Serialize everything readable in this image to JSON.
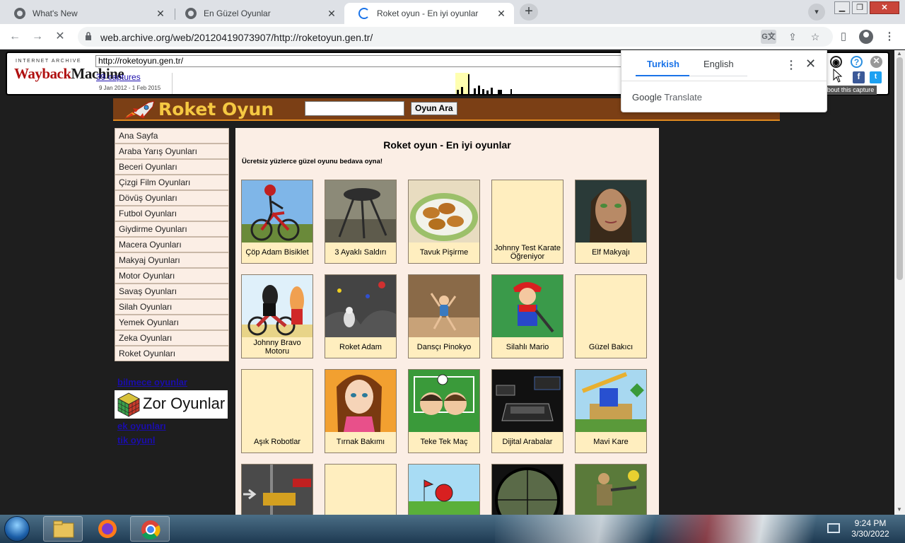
{
  "browser": {
    "tabs": [
      {
        "title": "What's New",
        "icon": "chrome-icon"
      },
      {
        "title": "En Güzel Oyunlar",
        "icon": "globe-icon"
      },
      {
        "title": "Roket oyun - En iyi oyunlar",
        "icon": "loading-spinner-icon",
        "active": true
      }
    ],
    "url": "web.archive.org/web/20120419073907/http://roketoyun.gen.tr/"
  },
  "wayback": {
    "brand_top": "INTERNET ARCHIVE",
    "brand_logo_a": "Wayback",
    "brand_logo_b": "Machine",
    "url_field": "http://roketoyun.gen.tr/",
    "captures": "39 captures",
    "date_range": "9 Jan 2012 - 1 Feb 2015",
    "about": "About this capture"
  },
  "translate_popup": {
    "lang_from": "Turkish",
    "lang_to": "English",
    "footer_brand": "Google",
    "footer_product": "Translate"
  },
  "site": {
    "title": "Roket Oyun",
    "search_button": "Oyun Ara",
    "search_value": ""
  },
  "sidebar": {
    "items": [
      "Ana Sayfa",
      "Araba Yarış Oyunları",
      "Beceri Oyunları",
      "Çizgi Film Oyunları",
      "Dövüş Oyunları",
      "Futbol Oyunları",
      "Giydirme Oyunları",
      "Macera Oyunları",
      "Makyaj Oyunları",
      "Motor Oyunları",
      "Savaş Oyunları",
      "Silah Oyunları",
      "Yemek Oyunları",
      "Zeka Oyunları",
      "Roket Oyunları"
    ],
    "links": [
      "bilmece oyunlar",
      "ek oyunları",
      "tik oyunl"
    ],
    "banner_text": "Zor Oyunlar"
  },
  "content": {
    "title": "Roket oyun - En iyi oyunlar",
    "subtitle": "Ücretsiz yüzlerce güzel oyunu bedava oyna!",
    "games": [
      {
        "label": "Çöp Adam Bisiklet",
        "thumb": "stickman-bike"
      },
      {
        "label": "3 Ayaklı Saldırı",
        "thumb": "tripod"
      },
      {
        "label": "Tavuk Pişirme",
        "thumb": "chicken"
      },
      {
        "label": "Johnny Test Karate Öğreniyor",
        "thumb": "blank"
      },
      {
        "label": "Elf Makyajı",
        "thumb": "elf"
      },
      {
        "label": "Johnny Bravo Motoru",
        "thumb": "bravo"
      },
      {
        "label": "Roket Adam",
        "thumb": "rocketman"
      },
      {
        "label": "Dansçı Pinokyo",
        "thumb": "pinocchio"
      },
      {
        "label": "Silahlı Mario",
        "thumb": "mario"
      },
      {
        "label": "Güzel Bakıcı",
        "thumb": "blank"
      },
      {
        "label": "Aşık Robotlar",
        "thumb": "blank"
      },
      {
        "label": "Tırnak Bakımı",
        "thumb": "nails"
      },
      {
        "label": "Teke Tek Maç",
        "thumb": "soccer"
      },
      {
        "label": "Dijital Arabalar",
        "thumb": "cars"
      },
      {
        "label": "Mavi Kare",
        "thumb": "bluebox"
      },
      {
        "label": "",
        "thumb": "truck"
      },
      {
        "label": "",
        "thumb": "blank"
      },
      {
        "label": "",
        "thumb": "redball"
      },
      {
        "label": "",
        "thumb": "scope"
      },
      {
        "label": "",
        "thumb": "soldier"
      }
    ]
  },
  "taskbar": {
    "time": "9:24 PM",
    "date": "3/30/2022"
  },
  "colors": {
    "site_header": "#7b3f15",
    "site_title": "#f5c842",
    "content_bg": "#fbeee5",
    "game_card": "#ffeebf",
    "accent_blue": "#1a73e8"
  }
}
